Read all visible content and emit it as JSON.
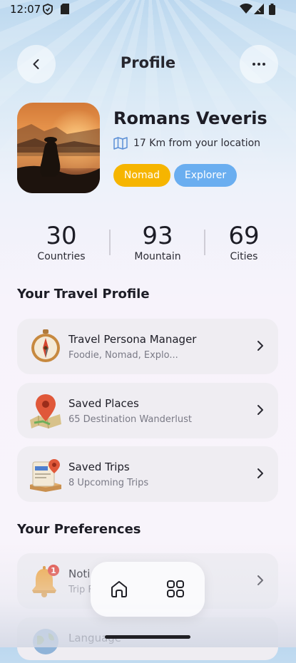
{
  "status_bar": {
    "time": "12:07"
  },
  "header": {
    "title": "Profile",
    "back_icon": "chevron-left-icon",
    "menu_icon": "more-horizontal-icon"
  },
  "profile": {
    "name": "Romans Veveris",
    "location": "17 Km from your location",
    "tags": [
      {
        "label": "Nomad",
        "color": "#f6b500"
      },
      {
        "label": "Explorer",
        "color": "#6aaef0"
      }
    ]
  },
  "stats": [
    {
      "value": "30",
      "label": "Countries"
    },
    {
      "value": "93",
      "label": "Mountain"
    },
    {
      "value": "69",
      "label": "Cities"
    }
  ],
  "travel_profile": {
    "heading": "Your Travel Profile",
    "items": [
      {
        "title": "Travel Persona Manager",
        "subtitle": "Foodie, Nomad, Explo...",
        "icon": "compass-icon"
      },
      {
        "title": "Saved Places",
        "subtitle": "65 Destination Wanderlust",
        "icon": "map-pin-icon"
      },
      {
        "title": "Saved Trips",
        "subtitle": "8 Upcoming Trips",
        "icon": "travel-ticket-icon"
      }
    ]
  },
  "preferences": {
    "heading": "Your Preferences",
    "items": [
      {
        "title": "Noti",
        "subtitle": "Trip F",
        "icon": "bell-icon",
        "badge": "1"
      },
      {
        "title": "Language",
        "subtitle": "",
        "icon": "globe-icon"
      }
    ]
  },
  "bottom_nav": {
    "items": [
      {
        "icon": "home-icon"
      },
      {
        "icon": "grid-icon"
      }
    ]
  }
}
